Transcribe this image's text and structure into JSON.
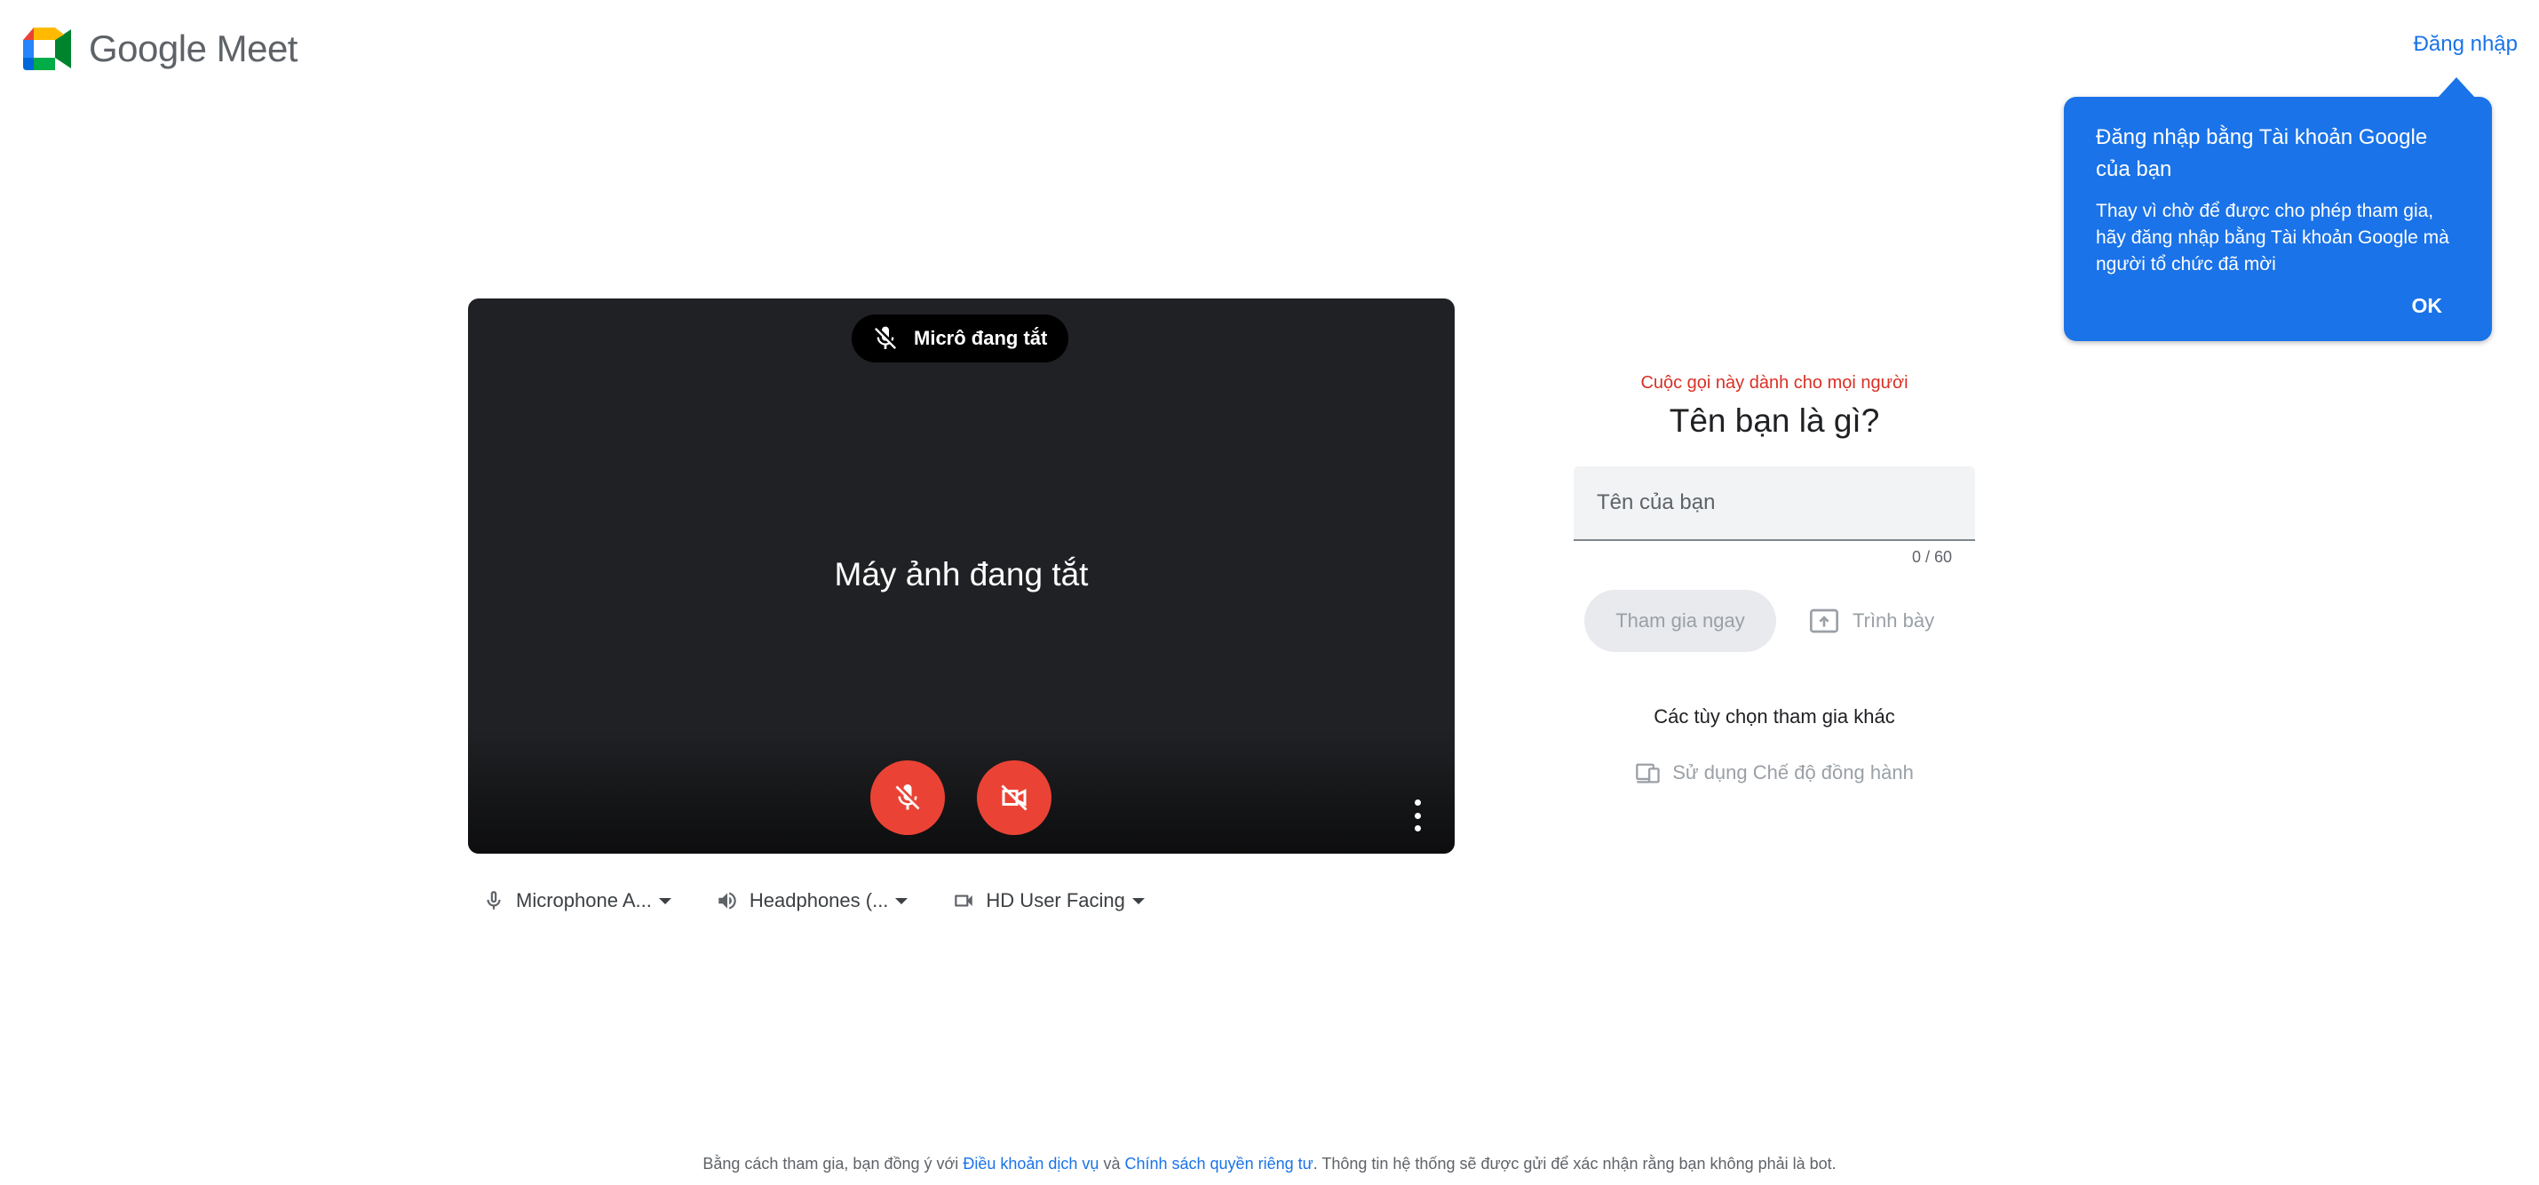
{
  "header": {
    "app_name": "Google Meet",
    "sign_in_label": "Đăng nhập"
  },
  "tooltip": {
    "title": "Đăng nhập bằng Tài khoản Google của bạn",
    "body": "Thay vì chờ để được cho phép tham gia, hãy đăng nhập bằng Tài khoản Google mà người tổ chức đã mời",
    "ok_label": "OK"
  },
  "preview": {
    "mic_status": "Micrô đang tắt",
    "camera_status": "Máy ảnh đang tắt",
    "mic_icon": "mic-off-icon",
    "camera_icon": "videocam-off-icon",
    "more_icon": "more-vert-icon"
  },
  "devices": {
    "microphone": "Microphone A...",
    "speaker": "Headphones (...",
    "camera": "HD User Facing"
  },
  "join": {
    "call_notice": "Cuộc gọi này dành cho mọi người",
    "question": "Tên bạn là gì?",
    "name_placeholder": "Tên của bạn",
    "name_value": "",
    "char_counter": "0 / 60",
    "join_now_label": "Tham gia ngay",
    "present_label": "Trình bày",
    "other_options_label": "Các tùy chọn tham gia khác",
    "companion_mode_label": "Sử dụng Chế độ đồng hành"
  },
  "footer": {
    "prefix": "Bằng cách tham gia, bạn đồng ý với",
    "terms_link": "Điều khoản dịch vụ",
    "and": "và",
    "privacy_link": "Chính sách quyền riêng tư",
    "suffix": ". Thông tin hệ thống sẽ được gửi để xác nhận rằng bạn không phải là bot."
  },
  "colors": {
    "accent": "#1a73e8",
    "danger": "#ea4335",
    "notice_red": "#d93025",
    "preview_bg": "#202124"
  }
}
